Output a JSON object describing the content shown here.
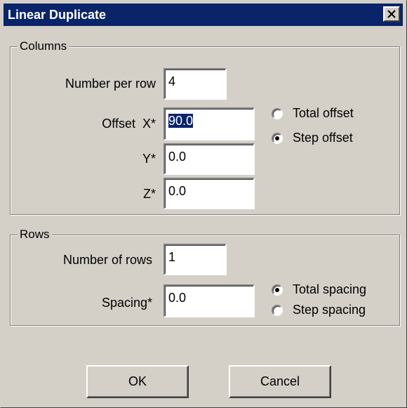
{
  "window": {
    "title": "Linear Duplicate"
  },
  "columns": {
    "legend": "Columns",
    "number_per_row_label": "Number per row",
    "number_per_row_value": "4",
    "offset_x_label": "Offset  X*",
    "offset_x_value": "90.0",
    "offset_y_label": "Y*",
    "offset_y_value": "0.0",
    "offset_z_label": "Z*",
    "offset_z_value": "0.0",
    "offset_mode_options": [
      {
        "label": "Total offset",
        "selected": false
      },
      {
        "label": "Step offset",
        "selected": true
      }
    ]
  },
  "rows": {
    "legend": "Rows",
    "number_of_rows_label": "Number of rows",
    "number_of_rows_value": "1",
    "spacing_label": "Spacing*",
    "spacing_value": "0.0",
    "spacing_mode_options": [
      {
        "label": "Total spacing",
        "selected": true
      },
      {
        "label": "Step spacing",
        "selected": false
      }
    ]
  },
  "buttons": {
    "ok": "OK",
    "cancel": "Cancel"
  },
  "colors": {
    "titlebar": "#0a246a",
    "dialog_face": "#d4d0c8",
    "selection": "#0a246a"
  },
  "icons": {
    "close": "close-icon"
  }
}
